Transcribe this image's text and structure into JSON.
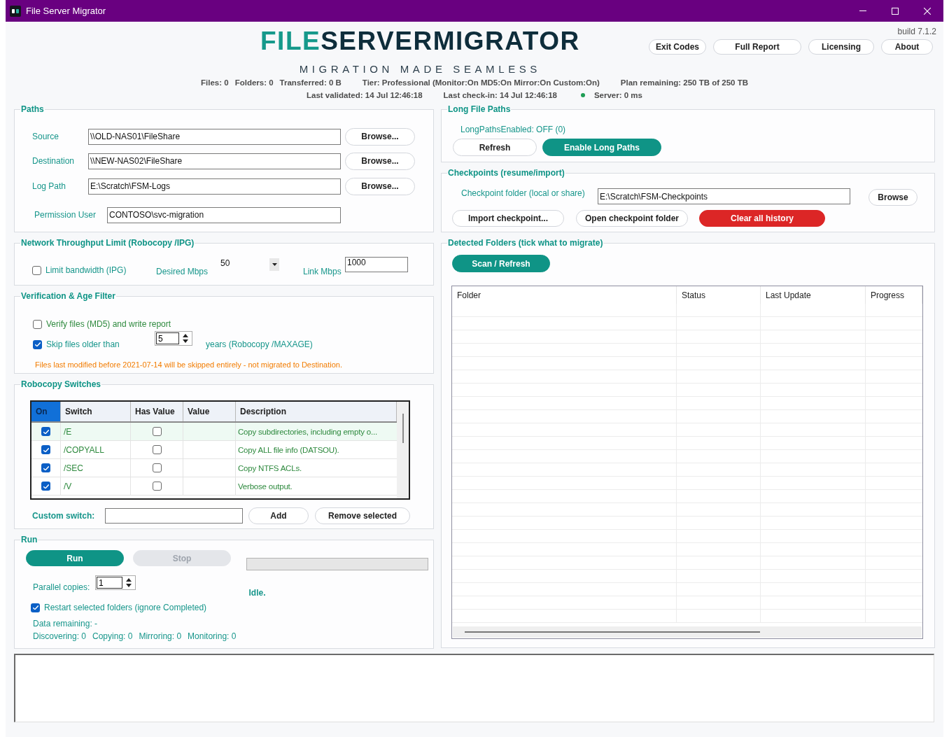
{
  "window": {
    "title": "File Server Migrator"
  },
  "header": {
    "logo": {
      "accent": "FILE",
      "rest": "SERVERMIGRATOR"
    },
    "tagline": "MIGRATION MADE SEAMLESS",
    "build": "build 7.1.2",
    "buttons": [
      "Exit Codes",
      "Full Report",
      "Licensing",
      "About"
    ],
    "counts": [
      "Files: 0",
      "Folders: 0",
      "Transferred: 0 B"
    ],
    "tier": "Tier: Professional (Monitor:On MD5:On Mirror:On Custom:On)",
    "plan": "Plan remaining: 250 TB of 250 TB",
    "last_validated": "Last validated: 14 Jul 12:46:18",
    "last_check_in": "Last check-in: 14 Jul 12:46:18",
    "server": {
      "text": "Server: 0 ms",
      "color": "#1f9d55"
    }
  },
  "paths": {
    "title": "Paths",
    "fields": [
      {
        "label": "Source",
        "value": "\\\\OLD-NAS01\\FileShare",
        "button": "Browse..."
      },
      {
        "label": "Destination",
        "value": "\\\\NEW-NAS02\\FileShare",
        "button": "Browse..."
      },
      {
        "label": "Log Path",
        "value": "E:\\Scratch\\FSM-Logs",
        "button": "Browse..."
      },
      {
        "label": "Permission User",
        "value": "CONTOSO\\svc-migration"
      }
    ]
  },
  "throughput": {
    "title": "Network Throughput Limit (Robocopy /IPG)",
    "limit_bandwidth": {
      "label": "Limit bandwidth (IPG)",
      "checked": false
    },
    "desired_mbps": {
      "label": "Desired Mbps",
      "value": "50"
    },
    "link_mbps": {
      "label": "Link Mbps",
      "value": "1000"
    }
  },
  "verification": {
    "title": "Verification & Age Filter",
    "verify": {
      "label": "Verify files (MD5) and write report",
      "checked": false
    },
    "skip_older": {
      "label": "Skip files older than",
      "checked": true,
      "value": "5",
      "suffix": "years (Robocopy /MAXAGE)"
    },
    "warning": "Files last modified before 2021-07-14 will be skipped entirely - not migrated to Destination."
  },
  "robocopy": {
    "title": "Robocopy Switches",
    "columns": [
      {
        "label": "On",
        "selected": true
      },
      {
        "label": "Switch",
        "selected": false
      },
      {
        "label": "Has Value",
        "selected": false
      },
      {
        "label": "Value",
        "selected": false
      },
      {
        "label": "Description",
        "selected": false
      }
    ],
    "rows": [
      {
        "on": true,
        "switch": "/E",
        "has_value": false,
        "description": "Copy subdirectories, including empty o...",
        "selected": true
      },
      {
        "on": true,
        "switch": "/COPYALL",
        "has_value": false,
        "description": "Copy ALL file info (DATSOU).",
        "selected": false
      },
      {
        "on": true,
        "switch": "/SEC",
        "has_value": false,
        "description": "Copy NTFS ACLs.",
        "selected": false
      },
      {
        "on": true,
        "switch": "/V",
        "has_value": false,
        "description": "Verbose output.",
        "selected": false
      }
    ],
    "custom_label": "Custom switch:",
    "buttons": [
      "Add",
      "Remove selected"
    ]
  },
  "run": {
    "title": "Run",
    "run_button": {
      "label": "Run",
      "disabled": false
    },
    "stop_button": {
      "label": "Stop",
      "disabled": true
    },
    "progress": {
      "level": 0
    },
    "parallel": {
      "label": "Parallel copies:",
      "value": "1"
    },
    "status": "Idle.",
    "restart": {
      "label": "Restart selected folders (ignore Completed)",
      "checked": true
    },
    "data_remaining": "Data remaining: -",
    "counters": [
      "Discovering: 0",
      "Copying: 0",
      "Mirroring: 0",
      "Monitoring: 0"
    ]
  },
  "long_paths": {
    "title": "Long File Paths",
    "status": "LongPathsEnabled: OFF (0)",
    "buttons": [
      {
        "label": "Refresh",
        "kind": "outline"
      },
      {
        "label": "Enable Long Paths",
        "kind": "primary"
      }
    ]
  },
  "checkpoints": {
    "title": "Checkpoints (resume/import)",
    "folder_label": "Checkpoint folder (local or share)",
    "folder_value": "E:\\Scratch\\FSM-Checkpoints",
    "browse": "Browse",
    "buttons": [
      {
        "label": "Import checkpoint...",
        "kind": "outline"
      },
      {
        "label": "Open checkpoint folder",
        "kind": "outline"
      },
      {
        "label": "Clear all history",
        "kind": "danger"
      }
    ]
  },
  "detected": {
    "title": "Detected Folders (tick what to migrate)",
    "scan_button": "Scan / Refresh",
    "columns": [
      "Folder",
      "Status",
      "Last Update",
      "Progress"
    ]
  }
}
